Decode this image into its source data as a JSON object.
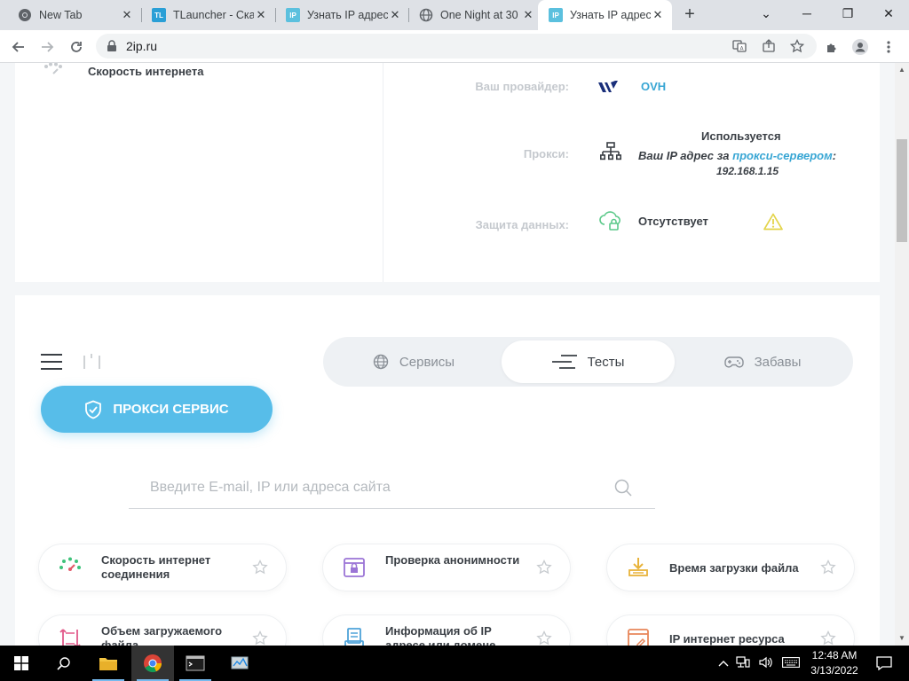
{
  "browser": {
    "tabs": [
      {
        "title": "New Tab",
        "favicon": "chrome-icon",
        "active": false
      },
      {
        "title": "TLauncher - Ска",
        "favicon": "tlauncher-icon",
        "active": false
      },
      {
        "title": "Узнать IP адрес",
        "favicon": "ip-icon",
        "active": false
      },
      {
        "title": "One Night at 30",
        "favicon": "globe-icon",
        "active": false
      },
      {
        "title": "Узнать IP адрес",
        "favicon": "ip-icon",
        "active": true
      }
    ],
    "favicon_text": {
      "ip": "IP",
      "tl": "TL"
    },
    "tab_close": "✕",
    "new_tab": "+",
    "window": {
      "minimize": "⌄",
      "restore": "❐",
      "close": "✕",
      "min_glyph": "─"
    },
    "address": "2ip.ru"
  },
  "page": {
    "top_card": {
      "speed_label": "Скорость интернета",
      "provider_label": "Ваш провайдер:",
      "provider_value": "OVH",
      "proxy_label": "Прокси:",
      "proxy_status": "Используется",
      "proxy_text_prefix": "Ваш IP адрес за ",
      "proxy_link": "прокси-сервером",
      "proxy_text_suffix": ":",
      "proxy_ip": "192.168.1.15",
      "protection_label": "Защита данных:",
      "protection_value": "Отсутствует"
    },
    "menu": {
      "tabs": [
        {
          "label": "Сервисы",
          "icon": "globe-icon",
          "active": false
        },
        {
          "label": "Тесты",
          "icon": "lines-icon",
          "active": true
        },
        {
          "label": "Забавы",
          "icon": "gamepad-icon",
          "active": false
        }
      ]
    },
    "proxy_button": "ПРОКСИ СЕРВИС",
    "search": {
      "placeholder": "Введите E-mail, IP или адреса сайта",
      "value": ""
    },
    "tiles": [
      {
        "label": "Скорость интернет соединения",
        "icon": "speedometer-icon"
      },
      {
        "label": "Проверка анонимности",
        "icon": "anonymity-icon"
      },
      {
        "label": "Время загрузки файла",
        "icon": "download-icon"
      },
      {
        "label": "Объем загружаемого файла",
        "icon": "file-size-icon"
      },
      {
        "label": "Информация об IP адресе или домене",
        "icon": "ip-info-icon"
      },
      {
        "label": "IP интернет ресурса",
        "icon": "web-resource-icon"
      }
    ]
  },
  "taskbar": {
    "time": "12:48 AM",
    "date": "3/13/2022"
  }
}
